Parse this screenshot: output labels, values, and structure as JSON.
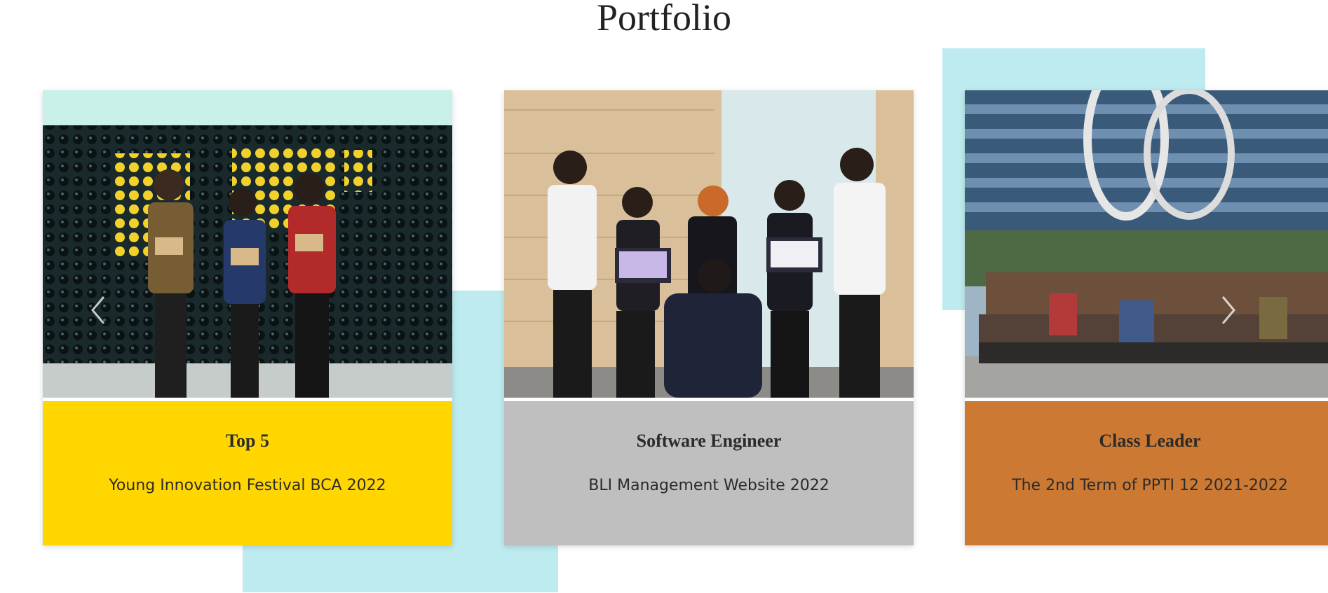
{
  "page": {
    "title": "Portfolio"
  },
  "colors": {
    "decor": "#bdebef",
    "card1": "#ffd600",
    "card2": "#bfbfbf",
    "card3": "#cc7a33"
  },
  "carousel": {
    "prev_icon": "chevron-left-icon",
    "next_icon": "chevron-right-icon",
    "items": [
      {
        "heading": "Top 5",
        "subtitle": "Young Innovation Festival BCA 2022"
      },
      {
        "heading": "Software Engineer",
        "subtitle": "BLI Management Website 2022"
      },
      {
        "heading": "Class Leader",
        "subtitle": "The 2nd Term of PPTI 12 2021-2022"
      }
    ]
  }
}
